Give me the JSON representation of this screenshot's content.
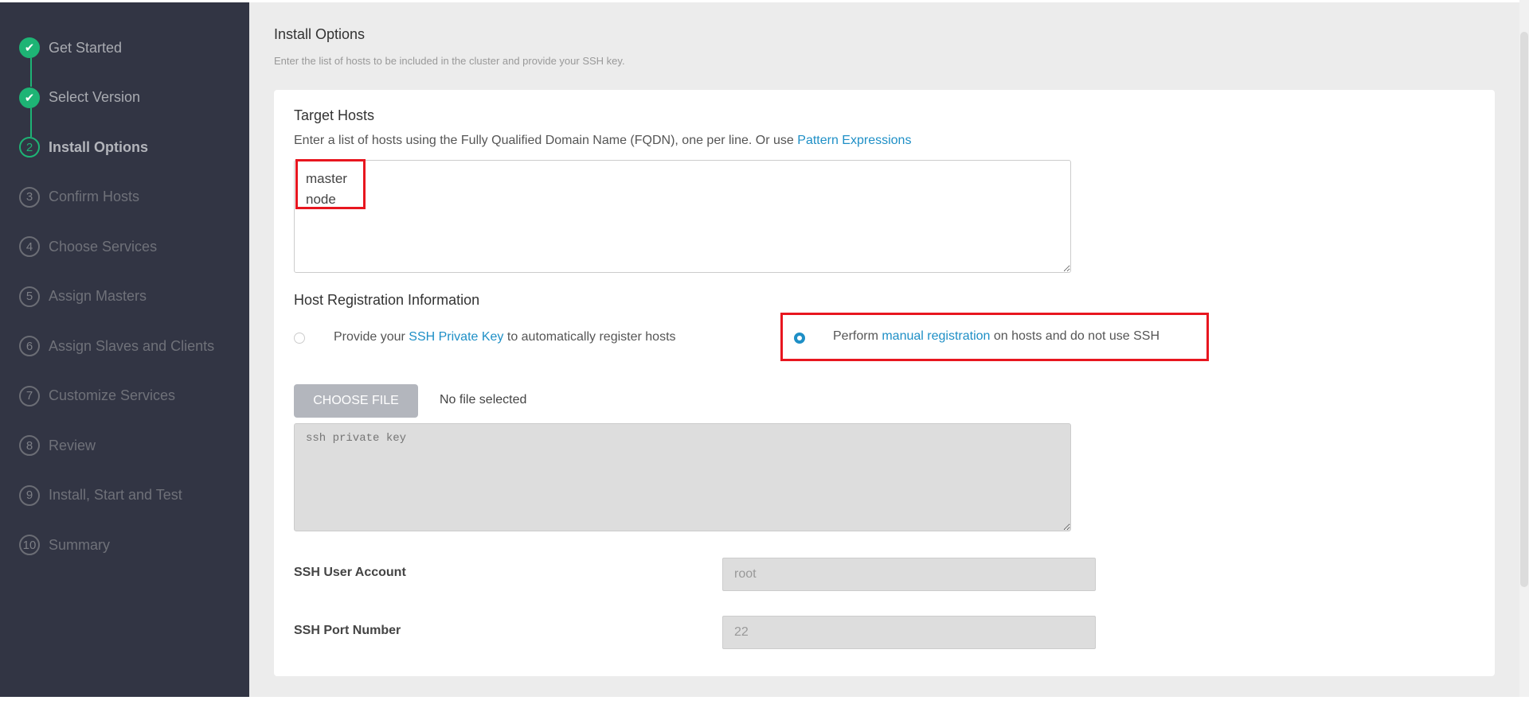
{
  "sidebar": {
    "steps": [
      {
        "marker": "✔",
        "label": "Get Started",
        "state": "done"
      },
      {
        "marker": "✔",
        "label": "Select Version",
        "state": "done"
      },
      {
        "marker": "2",
        "label": "Install Options",
        "state": "active"
      },
      {
        "marker": "3",
        "label": "Confirm Hosts",
        "state": "pending"
      },
      {
        "marker": "4",
        "label": "Choose Services",
        "state": "pending"
      },
      {
        "marker": "5",
        "label": "Assign Masters",
        "state": "pending"
      },
      {
        "marker": "6",
        "label": "Assign Slaves and Clients",
        "state": "pending"
      },
      {
        "marker": "7",
        "label": "Customize Services",
        "state": "pending"
      },
      {
        "marker": "8",
        "label": "Review",
        "state": "pending"
      },
      {
        "marker": "9",
        "label": "Install, Start and Test",
        "state": "pending"
      },
      {
        "marker": "10",
        "label": "Summary",
        "state": "pending"
      }
    ]
  },
  "page": {
    "title": "Install Options",
    "subtitle": "Enter the list of hosts to be included in the cluster and provide your SSH key."
  },
  "target_hosts": {
    "title": "Target Hosts",
    "desc_prefix": "Enter a list of hosts using the Fully Qualified Domain Name (FQDN), one per line. Or use ",
    "desc_link": "Pattern Expressions",
    "value": "master\nnode"
  },
  "registration": {
    "title": "Host Registration Information",
    "option1": {
      "prefix": "Provide your ",
      "link": "SSH Private Key",
      "suffix": " to automatically register hosts",
      "selected": false
    },
    "option2": {
      "prefix": "Perform ",
      "link": "manual registration",
      "suffix": " on hosts and do not use SSH",
      "selected": true
    },
    "choose_file": "CHOOSE FILE",
    "file_status": "No file selected",
    "key_placeholder": "ssh private key"
  },
  "ssh": {
    "user_label": "SSH User Account",
    "user_value": "root",
    "port_label": "SSH Port Number",
    "port_value": "22"
  },
  "colors": {
    "accent": "#1e8fc6",
    "success": "#1eb475",
    "highlight": "#e8161f",
    "sidebar": "#323544"
  }
}
